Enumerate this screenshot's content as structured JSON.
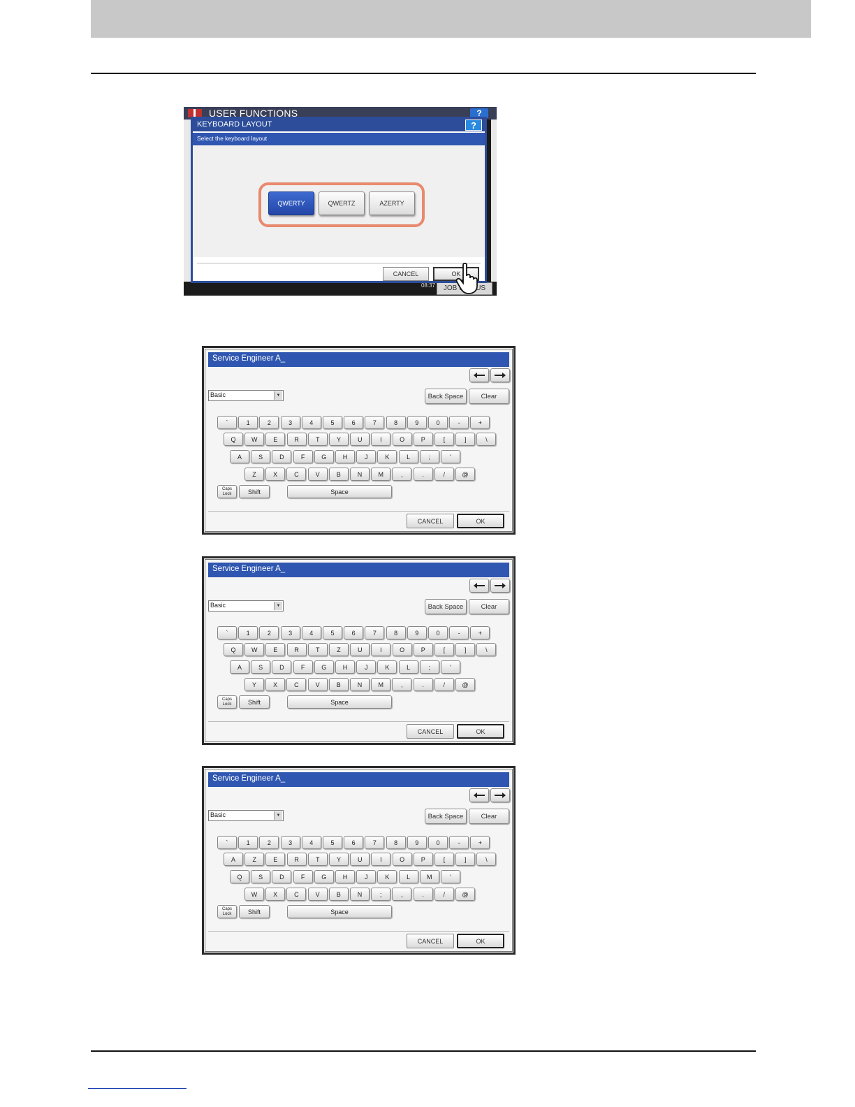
{
  "layout_dialog": {
    "app_title": "USER FUNCTIONS",
    "help_label": "?",
    "dialog_title": "KEYBOARD LAYOUT",
    "dialog_help_label": "?",
    "instruction": "Select the keyboard layout",
    "options": [
      {
        "label": "QWERTY",
        "selected": true
      },
      {
        "label": "QWERTZ",
        "selected": false
      },
      {
        "label": "AZERTY",
        "selected": false
      }
    ],
    "cancel_label": "CANCEL",
    "ok_label": "OK",
    "clock_time": "08:37",
    "job_status_label": "JOB STATUS"
  },
  "keyboards": [
    {
      "layout": "QWERTY",
      "input_text": "Service Engineer A_",
      "select_value": "Basic",
      "back_space_label": "Back Space",
      "clear_label": "Clear",
      "rows": [
        [
          "`",
          "1",
          "2",
          "3",
          "4",
          "5",
          "6",
          "7",
          "8",
          "9",
          "0",
          "-",
          "+"
        ],
        [
          "Q",
          "W",
          "E",
          "R",
          "T",
          "Y",
          "U",
          "I",
          "O",
          "P",
          "[",
          "]",
          "\\"
        ],
        [
          "A",
          "S",
          "D",
          "F",
          "G",
          "H",
          "J",
          "K",
          "L",
          ";",
          "'"
        ],
        [
          "Z",
          "X",
          "C",
          "V",
          "B",
          "N",
          "M",
          ",",
          ".",
          "/",
          "@"
        ]
      ],
      "caps_lock_label": [
        "Caps",
        "Lock"
      ],
      "shift_label": "Shift",
      "space_label": "Space",
      "cancel_label": "CANCEL",
      "ok_label": "OK"
    },
    {
      "layout": "QWERTZ",
      "input_text": "Service Engineer A_",
      "select_value": "Basic",
      "back_space_label": "Back Space",
      "clear_label": "Clear",
      "rows": [
        [
          "`",
          "1",
          "2",
          "3",
          "4",
          "5",
          "6",
          "7",
          "8",
          "9",
          "0",
          "-",
          "+"
        ],
        [
          "Q",
          "W",
          "E",
          "R",
          "T",
          "Z",
          "U",
          "I",
          "O",
          "P",
          "[",
          "]",
          "\\"
        ],
        [
          "A",
          "S",
          "D",
          "F",
          "G",
          "H",
          "J",
          "K",
          "L",
          ";",
          "'"
        ],
        [
          "Y",
          "X",
          "C",
          "V",
          "B",
          "N",
          "M",
          ",",
          ".",
          "/",
          "@"
        ]
      ],
      "caps_lock_label": [
        "Caps",
        "Lock"
      ],
      "shift_label": "Shift",
      "space_label": "Space",
      "cancel_label": "CANCEL",
      "ok_label": "OK"
    },
    {
      "layout": "AZERTY",
      "input_text": "Service Engineer A_",
      "select_value": "Basic",
      "back_space_label": "Back Space",
      "clear_label": "Clear",
      "rows": [
        [
          "`",
          "1",
          "2",
          "3",
          "4",
          "5",
          "6",
          "7",
          "8",
          "9",
          "0",
          "-",
          "+"
        ],
        [
          "A",
          "Z",
          "E",
          "R",
          "T",
          "Y",
          "U",
          "I",
          "O",
          "P",
          "[",
          "]",
          "\\"
        ],
        [
          "Q",
          "S",
          "D",
          "F",
          "G",
          "H",
          "J",
          "K",
          "L",
          "M",
          "'"
        ],
        [
          "W",
          "X",
          "C",
          "V",
          "B",
          "N",
          ";",
          ",",
          ".",
          "/",
          "@"
        ]
      ],
      "caps_lock_label": [
        "Caps",
        "Lock"
      ],
      "shift_label": "Shift",
      "space_label": "Space",
      "cancel_label": "CANCEL",
      "ok_label": "OK"
    }
  ]
}
